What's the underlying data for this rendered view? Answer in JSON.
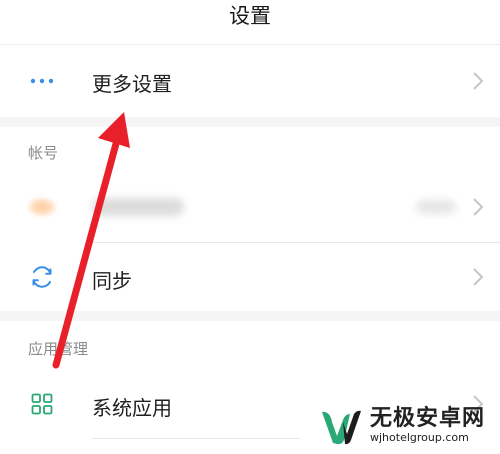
{
  "header": {
    "title": "设置"
  },
  "rows": {
    "more_settings": {
      "icon": "more-dots-icon",
      "label": "更多设置"
    },
    "sync": {
      "icon": "sync-icon",
      "label": "同步"
    },
    "system_apps": {
      "icon": "grid-icon",
      "label": "系统应用"
    }
  },
  "sections": {
    "account": {
      "header": "帐号"
    },
    "app_management": {
      "header": "应用管理"
    }
  },
  "watermark": {
    "title": "无极安卓网",
    "url": "wjhotelgroup.com"
  },
  "colors": {
    "accent_blue": "#3a8ee6",
    "accent_green": "#2aa877",
    "annotation_red": "#e8202a",
    "chevron": "#c6c6c6"
  }
}
